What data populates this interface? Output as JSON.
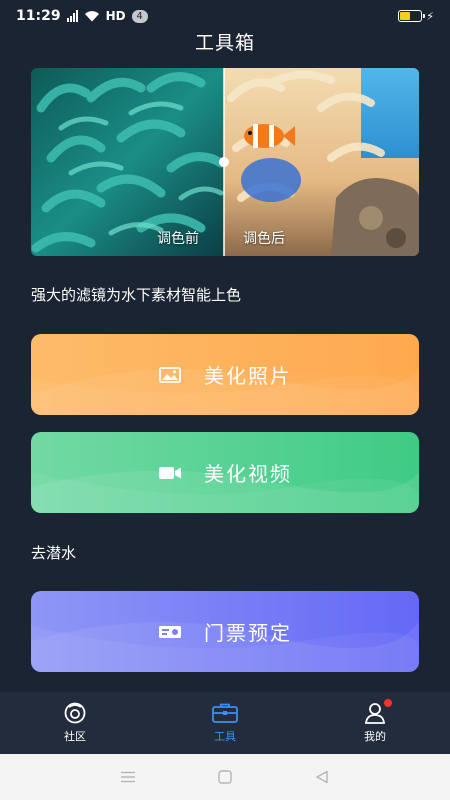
{
  "status_bar": {
    "time": "11:29",
    "network": "HD",
    "notification_count": "4"
  },
  "page_title": "工具箱",
  "compare": {
    "before_label": "调色前",
    "after_label": "调色后"
  },
  "tagline": "强大的滤镜为水下素材智能上色",
  "buttons": {
    "photo_label": "美化照片",
    "video_label": "美化视频",
    "ticket_label": "门票预定"
  },
  "section_dive": "去潜水",
  "bottom_nav": {
    "items": [
      {
        "label": "社区",
        "icon": "community-icon"
      },
      {
        "label": "工具",
        "icon": "toolbox-icon",
        "active": true
      },
      {
        "label": "我的",
        "icon": "profile-icon"
      }
    ]
  },
  "colors": {
    "background": "#1b2433",
    "active_tab": "#3f8ff0",
    "photo_button": "#fea94e",
    "video_button": "#3fcb84",
    "ticket_button": "#6468f6",
    "badge_dot": "#f2352a"
  }
}
